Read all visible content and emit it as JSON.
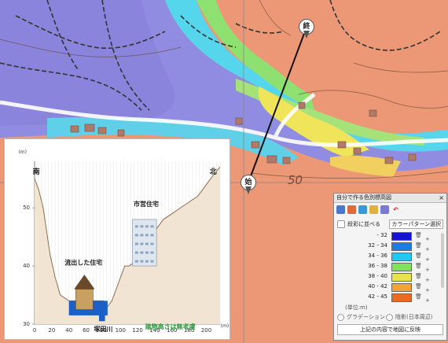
{
  "map": {
    "end_marker": "終",
    "start_marker": "始",
    "contour_label": "50"
  },
  "profile": {
    "y_unit": "(m)",
    "x_unit": "(m)",
    "south": "南",
    "north": "北",
    "house_label": "流出した住宅",
    "apartment_label": "市営住宅",
    "river_label": "塚田川",
    "note": "建物高さは無考慮",
    "y_ticks": [
      "30",
      "40",
      "50"
    ],
    "x_ticks": [
      "0",
      "20",
      "40",
      "60",
      "80",
      "100",
      "120",
      "140",
      "160",
      "180",
      "200"
    ],
    "chart_data": {
      "type": "line",
      "x": [
        0,
        5,
        10,
        14,
        18,
        24,
        30,
        40,
        50,
        60,
        70,
        80,
        85,
        90,
        100,
        105,
        110,
        120,
        130,
        140,
        150,
        160,
        170,
        180,
        190,
        200,
        210,
        216
      ],
      "y": [
        55,
        53,
        50,
        46,
        42,
        38,
        35,
        34,
        34,
        34,
        34,
        34,
        33,
        34,
        38,
        40,
        40,
        41,
        44,
        46,
        48,
        49,
        50,
        51,
        52,
        54,
        56,
        57
      ],
      "xlim": [
        0,
        216
      ],
      "ylim": [
        30,
        58
      ]
    }
  },
  "panel": {
    "title": "自分で作る色別標高図",
    "close": "×",
    "checkbox_label": "段彩に並べる",
    "pattern_select": "カラーパターン選択",
    "rows": [
      {
        "range": "- 32",
        "color": "#1414d0"
      },
      {
        "range": "32 - 34",
        "color": "#1a7ee6"
      },
      {
        "range": "34 - 36",
        "color": "#22c8ee"
      },
      {
        "range": "36 - 38",
        "color": "#7ee25a"
      },
      {
        "range": "38 - 40",
        "color": "#e6e44a"
      },
      {
        "range": "40 - 42",
        "color": "#f4a23a"
      },
      {
        "range": "42 - 45",
        "color": "#ee6a1e"
      }
    ],
    "unit_label": "(単位:m)",
    "gradient_label": "グラデーション",
    "shading_label": "陰影(日本周辺)",
    "apply_button": "上記の内容で地図に反映"
  }
}
